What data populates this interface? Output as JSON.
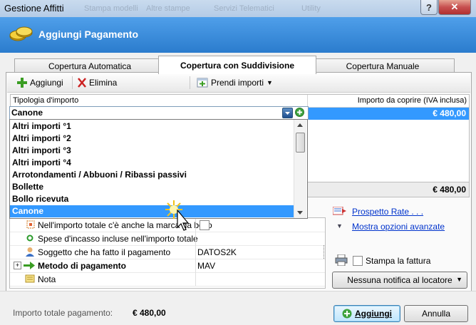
{
  "window": {
    "title": "Gestione Affitti",
    "background_tabs": [
      "Stampa modelli",
      "Altre stampe",
      "Servizi Telematici",
      "Utility"
    ]
  },
  "header": {
    "title": "Aggiungi Pagamento"
  },
  "tabs": [
    {
      "label": "Copertura Automatica"
    },
    {
      "label": "Copertura con Suddivisione",
      "active": true
    },
    {
      "label": "Copertura Manuale"
    }
  ],
  "toolbar": {
    "add_label": "Aggiungi",
    "delete_label": "Elimina",
    "fetch_label": "Prendi importi"
  },
  "grid": {
    "col_type": "Tipologia d'importo",
    "col_amount": "Importo da coprire (IVA inclusa)",
    "row_amount": "€ 480,00",
    "total_amount": "€ 480,00"
  },
  "combo": {
    "value": "Canone"
  },
  "dropdown": {
    "items": [
      "Altri importi °1",
      "Altri importi °2",
      "Altri importi °3",
      "Altri importi °4",
      "Arrotondamenti / Abbuoni / Ribassi passivi",
      "Bollette",
      "Bollo ricevuta",
      "Canone"
    ],
    "selected": "Canone"
  },
  "props": {
    "rows": [
      {
        "label": "Nell'importo totale c'è anche la marca da bollo",
        "value": ""
      },
      {
        "label": "Spese d'incasso incluse nell'importo totale",
        "value": ""
      },
      {
        "label": "Soggetto che ha fatto il pagamento",
        "value": "DATOS2K"
      },
      {
        "label": "Metodo di pagamento",
        "value": "MAV",
        "bold": true
      },
      {
        "label": "Nota",
        "value": ""
      }
    ]
  },
  "side": {
    "schedule_link": "Prospetto Rate . . .",
    "advanced_link": "Mostra opzioni avanzate",
    "print_invoice": "Stampa la fattura",
    "notify_select": "Nessuna notifica al locatore"
  },
  "footer": {
    "total_label": "Importo totale pagamento:",
    "total_value": "€ 480,00",
    "add_button": "Aggiungi",
    "cancel_button": "Annulla"
  },
  "colors": {
    "header": "#2b7ccd",
    "selection": "#3399ff",
    "link": "#0033cc"
  }
}
